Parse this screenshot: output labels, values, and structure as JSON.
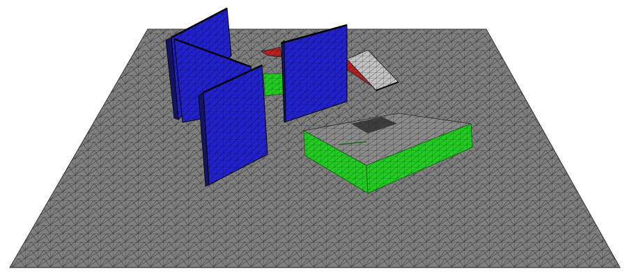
{
  "scene": {
    "description_colors": {
      "background": "#ffffff",
      "floor": "#808080",
      "mesh_line": "#1a1a1a",
      "wall_blue": "#2020c8",
      "wall_blue_edge": "#101060",
      "step_green": "#22cc22",
      "box_top": "#8a8a8a",
      "ramp_red": "#b82020",
      "ramp_top": "#c8c8c8",
      "shadow": "#303030"
    },
    "objects": [
      {
        "type": "floor",
        "color_key": "floor"
      },
      {
        "type": "wall",
        "color_key": "wall_blue"
      },
      {
        "type": "wall",
        "color_key": "wall_blue"
      },
      {
        "type": "wall",
        "color_key": "wall_blue"
      },
      {
        "type": "wall",
        "color_key": "wall_blue"
      },
      {
        "type": "step",
        "color_key": "step_green"
      },
      {
        "type": "ramp",
        "color_key": "ramp_red"
      },
      {
        "type": "box",
        "color_key": "step_green"
      }
    ]
  }
}
